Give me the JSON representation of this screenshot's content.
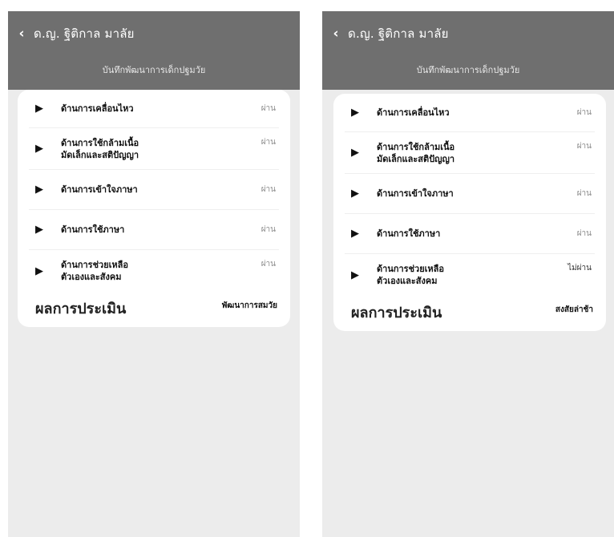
{
  "screens": [
    {
      "header": {
        "back_icon": "chevron-left-icon",
        "title": "ด.ญ. ฐิติกาล มาลัย"
      },
      "subheader": "บันทึกพัฒนาการเด็กปฐมวัย",
      "items": [
        {
          "label_lines": [
            "ด้านการเคลื่อนไหว"
          ],
          "status": "ผ่าน"
        },
        {
          "label_lines": [
            "ด้านการใช้กล้ามเนื้อ",
            "มัดเล็กและสติปัญญา"
          ],
          "status": "ผ่าน"
        },
        {
          "label_lines": [
            "ด้านการเข้าใจภาษา"
          ],
          "status": "ผ่าน"
        },
        {
          "label_lines": [
            "ด้านการใช้ภาษา"
          ],
          "status": "ผ่าน"
        },
        {
          "label_lines": [
            "ด้านการช่วยเหลือ",
            "ตัวเองและสังคม"
          ],
          "status": "ผ่าน"
        }
      ],
      "result": {
        "label": "ผลการประเมิน",
        "value": "พัฒนาการสมวัย"
      }
    },
    {
      "header": {
        "back_icon": "chevron-left-icon",
        "title": "ด.ญ. ฐิติกาล มาลัย"
      },
      "subheader": "บันทึกพัฒนาการเด็กปฐมวัย",
      "items": [
        {
          "label_lines": [
            "ด้านการเคลื่อนไหว"
          ],
          "status": "ผ่าน"
        },
        {
          "label_lines": [
            "ด้านการใช้กล้ามเนื้อ",
            "มัดเล็กและสติปัญญา"
          ],
          "status": "ผ่าน"
        },
        {
          "label_lines": [
            "ด้านการเข้าใจภาษา"
          ],
          "status": "ผ่าน"
        },
        {
          "label_lines": [
            "ด้านการใช้ภาษา"
          ],
          "status": "ผ่าน"
        },
        {
          "label_lines": [
            "ด้านการช่วยเหลือ",
            "ตัวเองและสังคม"
          ],
          "status": "ไม่ผ่าน"
        }
      ],
      "result": {
        "label": "ผลการประเมิน",
        "value": "สงสัยล่าช้า"
      }
    }
  ]
}
